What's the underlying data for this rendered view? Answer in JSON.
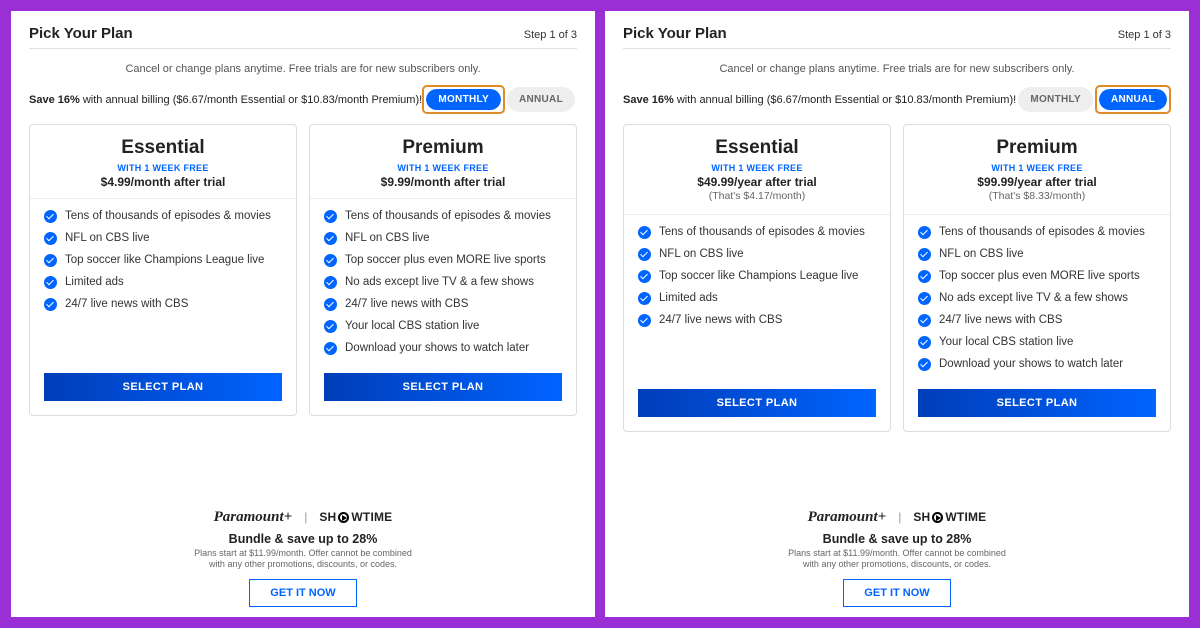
{
  "panels": [
    {
      "title": "Pick Your Plan",
      "step": "Step 1 of 3",
      "subtitle": "Cancel or change plans anytime. Free trials are for new subscribers only.",
      "save_bold": "Save 16%",
      "save_rest": " with annual billing ($6.67/month Essential or $10.83/month Premium)!",
      "toggle": {
        "monthly": "MONTHLY",
        "annual": "ANNUAL",
        "active": "monthly"
      },
      "plans": [
        {
          "name": "Essential",
          "trial": "WITH 1 WEEK FREE",
          "price": "$4.99/month after trial",
          "equiv": "",
          "features": [
            "Tens of thousands of episodes & movies",
            "NFL on CBS live",
            "Top soccer like Champions League live",
            "Limited ads",
            "24/7 live news with CBS"
          ],
          "cta": "SELECT PLAN"
        },
        {
          "name": "Premium",
          "trial": "WITH 1 WEEK FREE",
          "price": "$9.99/month after trial",
          "equiv": "",
          "features": [
            "Tens of thousands of episodes & movies",
            "NFL on CBS live",
            "Top soccer plus even MORE live sports",
            "No ads except live TV & a few shows",
            "24/7 live news with CBS",
            "Your local CBS station live",
            "Download your shows to watch later"
          ],
          "cta": "SELECT PLAN"
        }
      ],
      "bundle": {
        "logo1": "Paramount+",
        "logo2_pre": "SH",
        "logo2_post": "WTIME",
        "title": "Bundle & save up to 28%",
        "fine1": "Plans start at $11.99/month. Offer cannot be combined",
        "fine2": "with any other promotions, discounts, or codes.",
        "cta": "GET IT NOW"
      }
    },
    {
      "title": "Pick Your Plan",
      "step": "Step 1 of 3",
      "subtitle": "Cancel or change plans anytime. Free trials are for new subscribers only.",
      "save_bold": "Save 16%",
      "save_rest": " with annual billing ($6.67/month Essential or $10.83/month Premium)!",
      "toggle": {
        "monthly": "MONTHLY",
        "annual": "ANNUAL",
        "active": "annual"
      },
      "plans": [
        {
          "name": "Essential",
          "trial": "WITH 1 WEEK FREE",
          "price": "$49.99/year after trial",
          "equiv": "(That's $4.17/month)",
          "features": [
            "Tens of thousands of episodes & movies",
            "NFL on CBS live",
            "Top soccer like Champions League live",
            "Limited ads",
            "24/7 live news with CBS"
          ],
          "cta": "SELECT PLAN"
        },
        {
          "name": "Premium",
          "trial": "WITH 1 WEEK FREE",
          "price": "$99.99/year after trial",
          "equiv": "(That's $8.33/month)",
          "features": [
            "Tens of thousands of episodes & movies",
            "NFL on CBS live",
            "Top soccer plus even MORE live sports",
            "No ads except live TV & a few shows",
            "24/7 live news with CBS",
            "Your local CBS station live",
            "Download your shows to watch later"
          ],
          "cta": "SELECT PLAN"
        }
      ],
      "bundle": {
        "logo1": "Paramount+",
        "logo2_pre": "SH",
        "logo2_post": "WTIME",
        "title": "Bundle & save up to 28%",
        "fine1": "Plans start at $11.99/month. Offer cannot be combined",
        "fine2": "with any other promotions, discounts, or codes.",
        "cta": "GET IT NOW"
      }
    }
  ]
}
